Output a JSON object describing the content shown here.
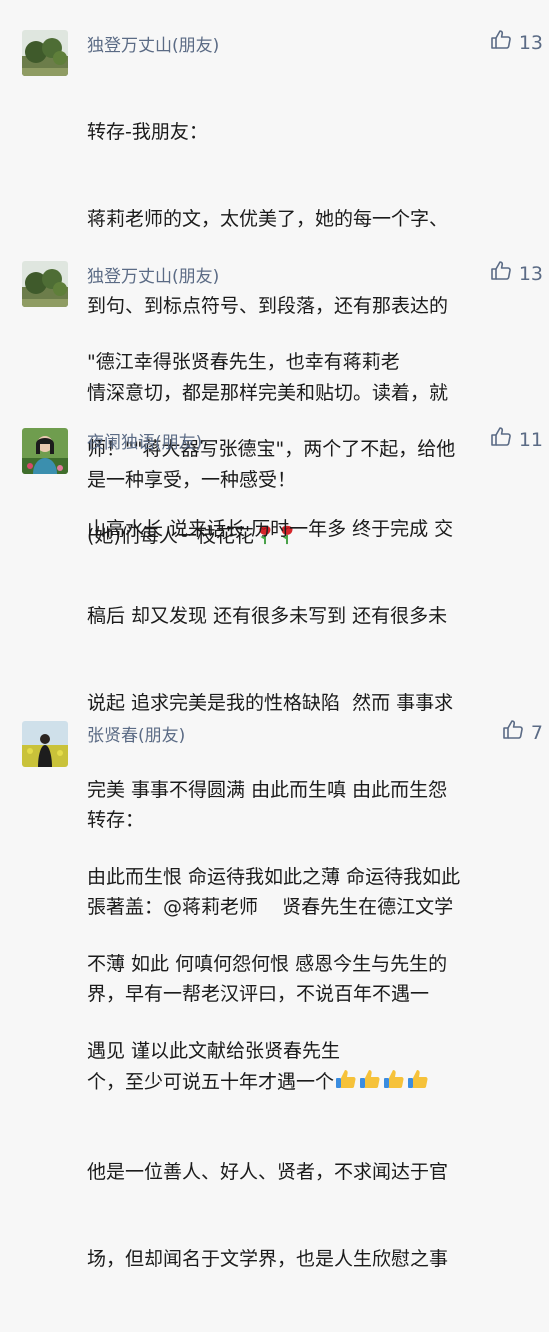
{
  "comments": [
    {
      "name": "独登万丈山(朋友)",
      "likes": "13",
      "lines": [
        "转存-我朋友：",
        "蒋莉老师的文，太优美了，她的每一个字、",
        "到句、到标点符号、到段落，还有那表达的",
        "情深意切，都是那样完美和贴切。读着，就",
        "是一种享受，一种感受！"
      ]
    },
    {
      "name": "独登万丈山(朋友)",
      "likes": "13",
      "lines": [
        "\"德江幸得张贤春先生，也幸有蒋莉老",
        "师！\"\"蒋大器写张德宝\"，两个了不起，给他",
        "(她)们每人一枝花花"
      ],
      "emoji": [
        "rose",
        "rose"
      ]
    },
    {
      "name": "夜阑独语(朋友)",
      "likes": "11",
      "lines": [
        "山高水长 说来话长 历时一年多 终于完成 交",
        "稿后 却又发现 还有很多未写到 还有很多未",
        "说起 追求完美是我的性格缺陷  然而 事事求",
        "完美 事事不得圆满 由此而生嗔 由此而生怨",
        "由此而生恨 命运待我如此之薄 命运待我如此",
        "不薄 如此 何嗔何怨何恨 感恩今生与先生的",
        "遇见 谨以此文献给张贤春先生"
      ]
    },
    {
      "name": "张贤春(朋友)",
      "likes": "7",
      "lines": [
        "转存：",
        "張著盖：@蒋莉老师    贤春先生在德江文学",
        "界，早有一帮老汉评曰，不说百年不遇一",
        "个，至少可说五十年才遇一个",
        "他是一位善人、好人、贤者，不求闻达于官",
        "场，但却闻名于文学界，也是人生欣慰之事"
      ],
      "emoji": [
        "thumbs-up",
        "thumbs-up",
        "thumbs-up",
        "thumbs-up"
      ]
    }
  ],
  "icons": {
    "like": "thumbs-up-outline-icon"
  },
  "colors": {
    "name": "#5b6b85",
    "text": "#1b1b1b",
    "background": "#f7f7f7"
  }
}
